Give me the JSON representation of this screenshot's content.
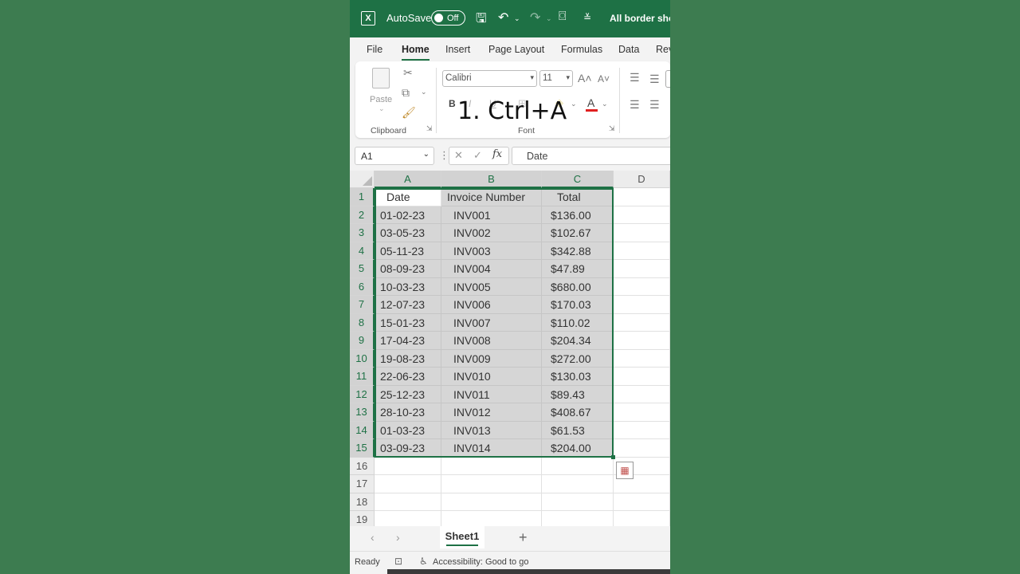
{
  "titlebar": {
    "autosave_label": "AutoSave",
    "autosave_state": "Off",
    "document_title": "All border shor"
  },
  "menu": [
    "File",
    "Home",
    "Insert",
    "Page Layout",
    "Formulas",
    "Data",
    "Rev"
  ],
  "active_menu": "Home",
  "ribbon": {
    "paste_label": "Paste",
    "clipboard_group": "Clipboard",
    "font_name": "Calibri",
    "font_size": "11",
    "font_group": "Font",
    "bold": "B",
    "italic": "I",
    "underline": "U",
    "font_color_glyph": "A"
  },
  "overlay": "1. Ctrl+A",
  "formula_bar": {
    "name_box": "A1",
    "content": "Date"
  },
  "columns": [
    "A",
    "B",
    "C",
    "D"
  ],
  "headers": [
    "Date",
    "Invoice Number",
    "Total"
  ],
  "rows": [
    [
      "01-02-23",
      "INV001",
      "$136.00"
    ],
    [
      "03-05-23",
      "INV002",
      "$102.67"
    ],
    [
      "05-11-23",
      "INV003",
      "$342.88"
    ],
    [
      "08-09-23",
      "INV004",
      "$47.89"
    ],
    [
      "10-03-23",
      "INV005",
      "$680.00"
    ],
    [
      "12-07-23",
      "INV006",
      "$170.03"
    ],
    [
      "15-01-23",
      "INV007",
      "$110.02"
    ],
    [
      "17-04-23",
      "INV008",
      "$204.34"
    ],
    [
      "19-08-23",
      "INV009",
      "$272.00"
    ],
    [
      "22-06-23",
      "INV010",
      "$130.03"
    ],
    [
      "25-12-23",
      "INV011",
      "$89.43"
    ],
    [
      "28-10-23",
      "INV012",
      "$408.67"
    ],
    [
      "01-03-23",
      "INV013",
      "$61.53"
    ],
    [
      "03-09-23",
      "INV014",
      "$204.00"
    ]
  ],
  "row_numbers": [
    "1",
    "2",
    "3",
    "4",
    "5",
    "6",
    "7",
    "8",
    "9",
    "10",
    "11",
    "12",
    "13",
    "14",
    "15",
    "16",
    "17",
    "18",
    "19"
  ],
  "sheet_tab": "Sheet1",
  "status": {
    "ready": "Ready",
    "accessibility": "Accessibility: Good to go"
  },
  "colors": {
    "excel_green": "#1e7145",
    "background": "#3d7c50",
    "selection_fill": "#d6d6d6"
  }
}
